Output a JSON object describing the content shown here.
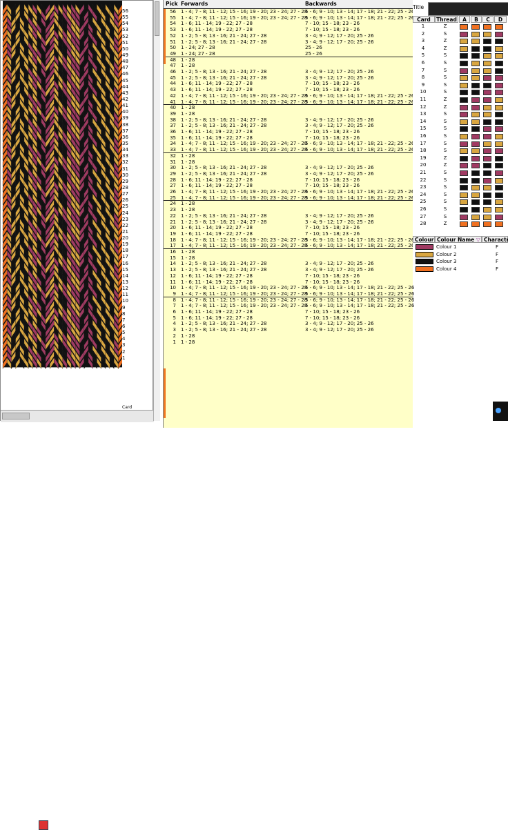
{
  "pattern": {
    "colors": [
      "#a03a62",
      "#d9a640",
      "#111111",
      "#f07020"
    ],
    "pick_numbers": [
      "56",
      "55",
      "54",
      "53",
      "52",
      "51",
      "50",
      "49",
      "48",
      "47",
      "46",
      "45",
      "44",
      "43",
      "42",
      "41",
      "40",
      "39",
      "38",
      "37",
      "36",
      "35",
      "34",
      "33",
      "32",
      "31",
      "30",
      "29",
      "28",
      "27",
      "26",
      "25",
      "24",
      "23",
      "22",
      "21",
      "20",
      "19",
      "18",
      "17",
      "16",
      "15",
      "14",
      "13",
      "12",
      "11",
      "10",
      "9",
      "8",
      "7",
      "6",
      "5",
      "4",
      "3",
      "2",
      "1"
    ],
    "footer_label": "Card",
    "footer_icon": "thread-pattern-icon"
  },
  "pick_table": {
    "headers": {
      "pick": "Pick",
      "forwards": "Forwards",
      "backwards": "Backwards"
    },
    "rows": [
      {
        "pick": "56",
        "fw": "1 - 4; 7 - 8; 11 - 12; 15 - 16; 19 - 20; 23 - 24; 27 - 28",
        "bw": "5 - 6; 9 - 10; 13 - 14; 17 - 18; 21 - 22; 25 - 26"
      },
      {
        "pick": "55",
        "fw": "1 - 4; 7 - 8; 11 - 12; 15 - 16; 19 - 20; 23 - 24; 27 - 28",
        "bw": "5 - 6; 9 - 10; 13 - 14; 17 - 18; 21 - 22; 25 - 26"
      },
      {
        "pick": "54",
        "fw": "1 - 6; 11 - 14; 19 - 22; 27 - 28",
        "bw": "7 - 10; 15 - 18; 23 - 26"
      },
      {
        "pick": "53",
        "fw": "1 - 6; 11 - 14; 19 - 22; 27 - 28",
        "bw": "7 - 10; 15 - 18; 23 - 26"
      },
      {
        "pick": "52",
        "fw": "1 - 2; 5 - 8; 13 - 16; 21 - 24; 27 - 28",
        "bw": "3 - 4; 9 - 12; 17 - 20; 25 - 26"
      },
      {
        "pick": "51",
        "fw": "1 - 2; 5 - 8; 13 - 16; 21 - 24; 27 - 28",
        "bw": "3 - 4; 9 - 12; 17 - 20; 25 - 26"
      },
      {
        "pick": "50",
        "fw": "1 - 24; 27 - 28",
        "bw": "25 - 26"
      },
      {
        "pick": "49",
        "fw": "1 - 24; 27 - 28",
        "bw": "25 - 26"
      },
      {
        "pick": "48",
        "fw": "1 - 28",
        "bw": ""
      },
      {
        "pick": "47",
        "fw": "1 - 28",
        "bw": ""
      },
      {
        "pick": "46",
        "fw": "1 - 2; 5 - 8; 13 - 16; 21 - 24; 27 - 28",
        "bw": "3 - 4; 9 - 12; 17 - 20; 25 - 26"
      },
      {
        "pick": "45",
        "fw": "1 - 2; 5 - 8; 13 - 16; 21 - 24; 27 - 28",
        "bw": "3 - 4; 9 - 12; 17 - 20; 25 - 26"
      },
      {
        "pick": "44",
        "fw": "1 - 6; 11 - 14; 19 - 22; 27 - 28",
        "bw": "7 - 10; 15 - 18; 23 - 26"
      },
      {
        "pick": "43",
        "fw": "1 - 6; 11 - 14; 19 - 22; 27 - 28",
        "bw": "7 - 10; 15 - 18; 23 - 26"
      },
      {
        "pick": "42",
        "fw": "1 - 4; 7 - 8; 11 - 12; 15 - 16; 19 - 20; 23 - 24; 27 - 28",
        "bw": "5 - 6; 9 - 10; 13 - 14; 17 - 18; 21 - 22; 25 - 26"
      },
      {
        "pick": "41",
        "fw": "1 - 4; 7 - 8; 11 - 12; 15 - 16; 19 - 20; 23 - 24; 27 - 28",
        "bw": "5 - 6; 9 - 10; 13 - 14; 17 - 18; 21 - 22; 25 - 26"
      },
      {
        "pick": "40",
        "fw": "1 - 28",
        "bw": ""
      },
      {
        "pick": "39",
        "fw": "1 - 28",
        "bw": ""
      },
      {
        "pick": "38",
        "fw": "1 - 2; 5 - 8; 13 - 16; 21 - 24; 27 - 28",
        "bw": "3 - 4; 9 - 12; 17 - 20; 25 - 26"
      },
      {
        "pick": "37",
        "fw": "1 - 2; 5 - 8; 13 - 16; 21 - 24; 27 - 28",
        "bw": "3 - 4; 9 - 12; 17 - 20; 25 - 26"
      },
      {
        "pick": "36",
        "fw": "1 - 6; 11 - 14; 19 - 22; 27 - 28",
        "bw": "7 - 10; 15 - 18; 23 - 26"
      },
      {
        "pick": "35",
        "fw": "1 - 6; 11 - 14; 19 - 22; 27 - 28",
        "bw": "7 - 10; 15 - 18; 23 - 26"
      },
      {
        "pick": "34",
        "fw": "1 - 4; 7 - 8; 11 - 12; 15 - 16; 19 - 20; 23 - 24; 27 - 28",
        "bw": "5 - 6; 9 - 10; 13 - 14; 17 - 18; 21 - 22; 25 - 26"
      },
      {
        "pick": "33",
        "fw": "1 - 4; 7 - 8; 11 - 12; 15 - 16; 19 - 20; 23 - 24; 27 - 28",
        "bw": "5 - 6; 9 - 10; 13 - 14; 17 - 18; 21 - 22; 25 - 26"
      },
      {
        "pick": "32",
        "fw": "1 - 28",
        "bw": ""
      },
      {
        "pick": "31",
        "fw": "1 - 28",
        "bw": ""
      },
      {
        "pick": "30",
        "fw": "1 - 2; 5 - 8; 13 - 16; 21 - 24; 27 - 28",
        "bw": "3 - 4; 9 - 12; 17 - 20; 25 - 26"
      },
      {
        "pick": "29",
        "fw": "1 - 2; 5 - 8; 13 - 16; 21 - 24; 27 - 28",
        "bw": "3 - 4; 9 - 12; 17 - 20; 25 - 26"
      },
      {
        "pick": "28",
        "fw": "1 - 6; 11 - 14; 19 - 22; 27 - 28",
        "bw": "7 - 10; 15 - 18; 23 - 26"
      },
      {
        "pick": "27",
        "fw": "1 - 6; 11 - 14; 19 - 22; 27 - 28",
        "bw": "7 - 10; 15 - 18; 23 - 26"
      },
      {
        "pick": "26",
        "fw": "1 - 4; 7 - 8; 11 - 12; 15 - 16; 19 - 20; 23 - 24; 27 - 28",
        "bw": "5 - 6; 9 - 10; 13 - 14; 17 - 18; 21 - 22; 25 - 26"
      },
      {
        "pick": "25",
        "fw": "1 - 4; 7 - 8; 11 - 12; 15 - 16; 19 - 20; 23 - 24; 27 - 28",
        "bw": "5 - 6; 9 - 10; 13 - 14; 17 - 18; 21 - 22; 25 - 26"
      },
      {
        "pick": "24",
        "fw": "1 - 28",
        "bw": ""
      },
      {
        "pick": "23",
        "fw": "1 - 28",
        "bw": ""
      },
      {
        "pick": "22",
        "fw": "1 - 2; 5 - 8; 13 - 16; 21 - 24; 27 - 28",
        "bw": "3 - 4; 9 - 12; 17 - 20; 25 - 26"
      },
      {
        "pick": "21",
        "fw": "1 - 2; 5 - 8; 13 - 16; 21 - 24; 27 - 28",
        "bw": "3 - 4; 9 - 12; 17 - 20; 25 - 26"
      },
      {
        "pick": "20",
        "fw": "1 - 6; 11 - 14; 19 - 22; 27 - 28",
        "bw": "7 - 10; 15 - 18; 23 - 26"
      },
      {
        "pick": "19",
        "fw": "1 - 6; 11 - 14; 19 - 22; 27 - 28",
        "bw": "7 - 10; 15 - 18; 23 - 26"
      },
      {
        "pick": "18",
        "fw": "1 - 4; 7 - 8; 11 - 12; 15 - 16; 19 - 20; 23 - 24; 27 - 28",
        "bw": "5 - 6; 9 - 10; 13 - 14; 17 - 18; 21 - 22; 25 - 26"
      },
      {
        "pick": "17",
        "fw": "1 - 4; 7 - 8; 11 - 12; 15 - 16; 19 - 20; 23 - 24; 27 - 28",
        "bw": "5 - 6; 9 - 10; 13 - 14; 17 - 18; 21 - 22; 25 - 26"
      },
      {
        "pick": "16",
        "fw": "1 - 28",
        "bw": ""
      },
      {
        "pick": "15",
        "fw": "1 - 28",
        "bw": ""
      },
      {
        "pick": "14",
        "fw": "1 - 2; 5 - 8; 13 - 16; 21 - 24; 27 - 28",
        "bw": "3 - 4; 9 - 12; 17 - 20; 25 - 26"
      },
      {
        "pick": "13",
        "fw": "1 - 2; 5 - 8; 13 - 16; 21 - 24; 27 - 28",
        "bw": "3 - 4; 9 - 12; 17 - 20; 25 - 26"
      },
      {
        "pick": "12",
        "fw": "1 - 6; 11 - 14; 19 - 22; 27 - 28",
        "bw": "7 - 10; 15 - 18; 23 - 26"
      },
      {
        "pick": "11",
        "fw": "1 - 6; 11 - 14; 19 - 22; 27 - 28",
        "bw": "7 - 10; 15 - 18; 23 - 26"
      },
      {
        "pick": "10",
        "fw": "1 - 4; 7 - 8; 11 - 12; 15 - 16; 19 - 20; 23 - 24; 27 - 28",
        "bw": "5 - 6; 9 - 10; 13 - 14; 17 - 18; 21 - 22; 25 - 26"
      },
      {
        "pick": "9",
        "fw": "1 - 4; 7 - 8; 11 - 12; 15 - 16; 19 - 20; 23 - 24; 27 - 28",
        "bw": "5 - 6; 9 - 10; 13 - 14; 17 - 18; 21 - 22; 25 - 26"
      },
      {
        "pick": "8",
        "fw": "1 - 4; 7 - 8; 11 - 12; 15 - 16; 19 - 20; 23 - 24; 27 - 28",
        "bw": "5 - 6; 9 - 10; 13 - 14; 17 - 18; 21 - 22; 25 - 26"
      },
      {
        "pick": "7",
        "fw": "1 - 4; 7 - 8; 11 - 12; 15 - 16; 19 - 20; 23 - 24; 27 - 28",
        "bw": "5 - 6; 9 - 10; 13 - 14; 17 - 18; 21 - 22; 25 - 26"
      },
      {
        "pick": "6",
        "fw": "1 - 6; 11 - 14; 19 - 22; 27 - 28",
        "bw": "7 - 10; 15 - 18; 23 - 26"
      },
      {
        "pick": "5",
        "fw": "1 - 6; 11 - 14; 19 - 22; 27 - 28",
        "bw": "7 - 10; 15 - 18; 23 - 26"
      },
      {
        "pick": "4",
        "fw": "1 - 2; 5 - 8; 13 - 16; 21 - 24; 27 - 28",
        "bw": "3 - 4; 9 - 12; 17 - 20; 25 - 26"
      },
      {
        "pick": "3",
        "fw": "1 - 2; 5 - 8; 13 - 16; 21 - 24; 27 - 28",
        "bw": "3 - 4; 9 - 12; 17 - 20; 25 - 26"
      },
      {
        "pick": "2",
        "fw": "1 - 28",
        "bw": ""
      },
      {
        "pick": "1",
        "fw": "1 - 28",
        "bw": ""
      }
    ]
  },
  "card_panel": {
    "title_label": "Title",
    "headers": {
      "card": "Card",
      "thread": "Thread",
      "a": "A",
      "b": "B",
      "c": "C",
      "d": "D"
    },
    "cards": [
      {
        "card": "1",
        "thread": "Z",
        "holes": [
          3,
          3,
          3,
          3
        ]
      },
      {
        "card": "2",
        "thread": "S",
        "holes": [
          0,
          1,
          1,
          0
        ]
      },
      {
        "card": "3",
        "thread": "Z",
        "holes": [
          1,
          1,
          2,
          2
        ]
      },
      {
        "card": "4",
        "thread": "Z",
        "holes": [
          1,
          2,
          2,
          1
        ]
      },
      {
        "card": "5",
        "thread": "S",
        "holes": [
          2,
          2,
          1,
          1
        ]
      },
      {
        "card": "6",
        "thread": "S",
        "holes": [
          2,
          1,
          1,
          2
        ]
      },
      {
        "card": "7",
        "thread": "S",
        "holes": [
          0,
          1,
          1,
          2
        ]
      },
      {
        "card": "8",
        "thread": "S",
        "holes": [
          1,
          1,
          0,
          0
        ]
      },
      {
        "card": "9",
        "thread": "S",
        "holes": [
          1,
          2,
          2,
          0
        ]
      },
      {
        "card": "10",
        "thread": "S",
        "holes": [
          2,
          2,
          0,
          0
        ]
      },
      {
        "card": "11",
        "thread": "Z",
        "holes": [
          2,
          0,
          0,
          1
        ]
      },
      {
        "card": "12",
        "thread": "Z",
        "holes": [
          0,
          0,
          1,
          1
        ]
      },
      {
        "card": "13",
        "thread": "S",
        "holes": [
          0,
          1,
          1,
          2
        ]
      },
      {
        "card": "14",
        "thread": "S",
        "holes": [
          1,
          1,
          2,
          2
        ]
      },
      {
        "card": "15",
        "thread": "S",
        "holes": [
          2,
          2,
          0,
          0
        ]
      },
      {
        "card": "16",
        "thread": "S",
        "holes": [
          1,
          0,
          0,
          1
        ]
      },
      {
        "card": "17",
        "thread": "S",
        "holes": [
          0,
          0,
          1,
          1
        ]
      },
      {
        "card": "18",
        "thread": "S",
        "holes": [
          1,
          1,
          0,
          0
        ]
      },
      {
        "card": "19",
        "thread": "Z",
        "holes": [
          2,
          0,
          0,
          2
        ]
      },
      {
        "card": "20",
        "thread": "Z",
        "holes": [
          0,
          0,
          2,
          2
        ]
      },
      {
        "card": "21",
        "thread": "S",
        "holes": [
          0,
          2,
          2,
          0
        ]
      },
      {
        "card": "22",
        "thread": "S",
        "holes": [
          2,
          2,
          0,
          1
        ]
      },
      {
        "card": "23",
        "thread": "S",
        "holes": [
          2,
          1,
          1,
          2
        ]
      },
      {
        "card": "24",
        "thread": "S",
        "holes": [
          1,
          1,
          2,
          2
        ]
      },
      {
        "card": "25",
        "thread": "S",
        "holes": [
          1,
          2,
          2,
          1
        ]
      },
      {
        "card": "26",
        "thread": "S",
        "holes": [
          2,
          2,
          1,
          1
        ]
      },
      {
        "card": "27",
        "thread": "S",
        "holes": [
          0,
          1,
          1,
          0
        ]
      },
      {
        "card": "28",
        "thread": "Z",
        "holes": [
          3,
          3,
          3,
          3
        ]
      }
    ]
  },
  "colour_panel": {
    "headers": {
      "colour": "Colour",
      "name": "Colour Name",
      "character": "Characte"
    },
    "colours": [
      {
        "name": "Colour 1",
        "char": "F",
        "hex": "#a03a62"
      },
      {
        "name": "Colour 2",
        "char": "F",
        "hex": "#d9a640"
      },
      {
        "name": "Colour 3",
        "char": "F",
        "hex": "#111111"
      },
      {
        "name": "Colour 4",
        "char": "F",
        "hex": "#f07020"
      }
    ]
  }
}
